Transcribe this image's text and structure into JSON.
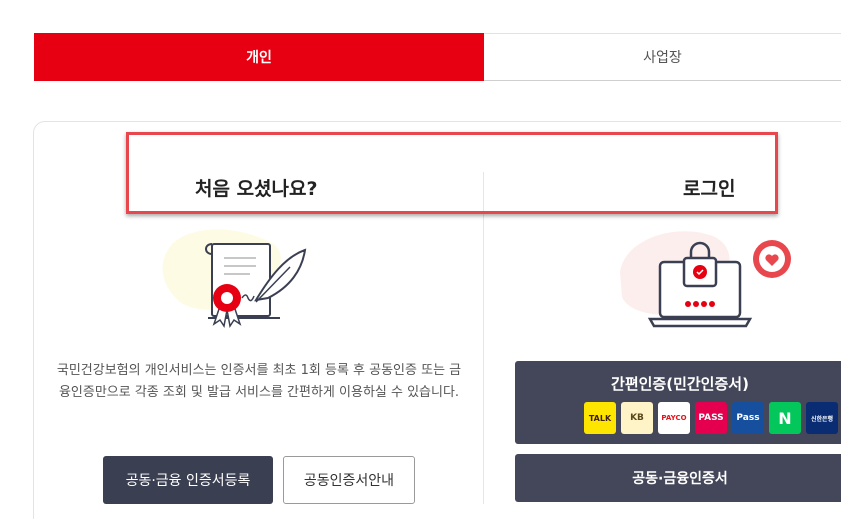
{
  "tabs": [
    {
      "label": "개인",
      "active": true
    },
    {
      "label": "사업장",
      "active": false
    }
  ],
  "left": {
    "heading": "처음 오셨나요?",
    "description": "국민건강보험의 개인서비스는 인증서를 최초 1회 등록 후 공동인증 또는 금융인증만으로 각종 조회 및 발급 서비스를 간편하게 이용하실 수 있습니다.",
    "register_button": "공동·금융 인증서등록",
    "guide_button": "공동인증서안내"
  },
  "right": {
    "heading": "로그인",
    "simple_auth": {
      "label": "간편인증(민간인증서)",
      "providers": [
        {
          "name": "kakao",
          "text": "TALK"
        },
        {
          "name": "kb",
          "text": "KB"
        },
        {
          "name": "payco",
          "text": "PAYCO"
        },
        {
          "name": "pass-1",
          "text": "PASS"
        },
        {
          "name": "pass-2",
          "text": "Pass"
        },
        {
          "name": "naver",
          "text": "N"
        },
        {
          "name": "shinhan",
          "text": "신한은행"
        }
      ]
    },
    "cert_button": "공동·금융인증서"
  },
  "colors": {
    "accent": "#e60012",
    "dark_button": "#3b3f52",
    "highlight": "#e8474e"
  },
  "icons": [
    "certificate-scroll-icon",
    "feather-pen-icon",
    "ribbon-seal-icon",
    "laptop-lock-icon",
    "heart-chat-icon"
  ]
}
